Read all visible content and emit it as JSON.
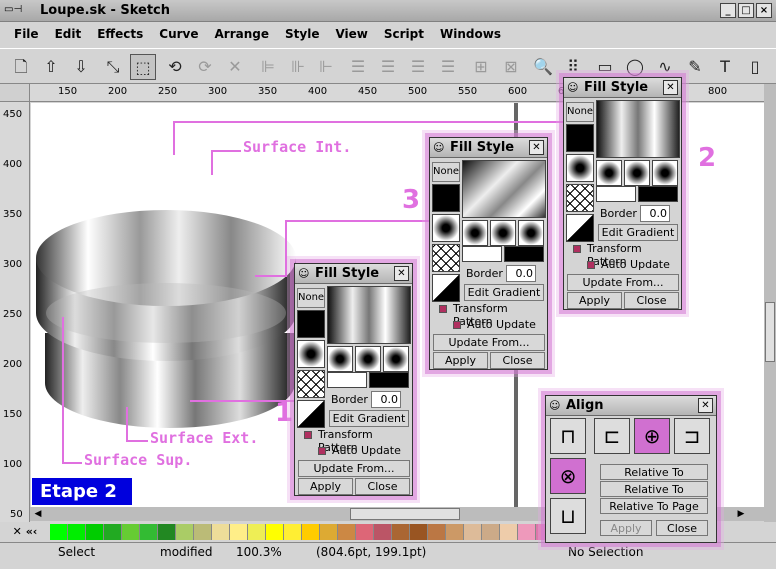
{
  "window": {
    "title": "Loupe.sk - Sketch",
    "controls": [
      "_",
      "□",
      "×"
    ]
  },
  "menu": [
    "File",
    "Edit",
    "Effects",
    "Curve",
    "Arrange",
    "Style",
    "View",
    "Script",
    "Windows"
  ],
  "rulers": {
    "h_labels": [
      "150",
      "200",
      "250",
      "300",
      "350",
      "400",
      "450",
      "500",
      "550",
      "600",
      "650",
      "700",
      "750",
      "800"
    ],
    "v_labels": [
      "450",
      "400",
      "350",
      "300",
      "250",
      "200",
      "150",
      "100",
      "50"
    ]
  },
  "annotations": {
    "surface_int": "Surface Int.",
    "surface_ext": "Surface Ext.",
    "surface_sup": "Surface Sup.",
    "num1": "1",
    "num2": "2",
    "num3": "3",
    "etape": "Etape 2"
  },
  "fill_style": {
    "title": "Fill Style",
    "none": "None",
    "border_label": "Border",
    "border_value": "0.0",
    "edit_gradient": "Edit Gradient",
    "transform_pattern": "Transform Pattern",
    "auto_update": "Auto Update",
    "update_from": "Update From...",
    "apply": "Apply",
    "close": "Close"
  },
  "align": {
    "title": "Align",
    "relative_selection": "Relative To Selection",
    "relative_lowermost": "Relative To Lowermost",
    "relative_page": "Relative To Page",
    "apply": "Apply",
    "close": "Close"
  },
  "palette": {
    "colors": [
      "#00ff00",
      "#00ee00",
      "#00cc00",
      "#22aa22",
      "#66cc33",
      "#33bb33",
      "#228822",
      "#aacc66",
      "#bbbb77",
      "#eedd99",
      "#ffee88",
      "#eeee55",
      "#ffff00",
      "#ffee33",
      "#ffcc00",
      "#ddaa33",
      "#cc8844",
      "#dd6677",
      "#bb5566",
      "#aa6633",
      "#995522",
      "#bb7744",
      "#cc9966",
      "#ddbb99",
      "#ccaa88",
      "#eeccaa",
      "#ee99bb",
      "#dd77aa",
      "#ee66cc",
      "#ff33cc",
      "#ff00ff",
      "#cc44cc",
      "#9944bb",
      "#dd55dd"
    ],
    "nav_left": "✕ «‹",
    "nav_right": "›»"
  },
  "status": {
    "mode": "Select",
    "modified": "modified",
    "zoom": "100.3%",
    "coords": "(804.6pt, 199.1pt)",
    "selection": "No Selection"
  }
}
